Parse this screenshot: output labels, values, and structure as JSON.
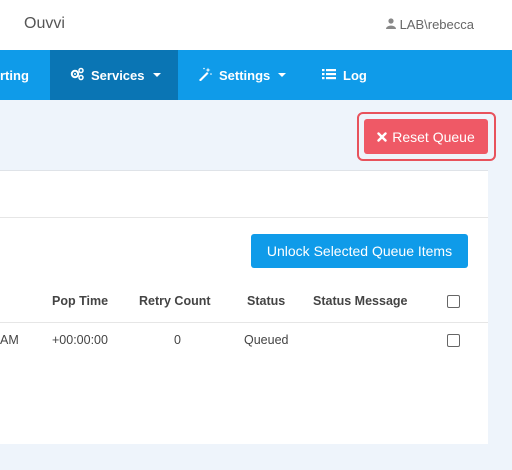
{
  "header": {
    "brand": "Ouvvi",
    "user": "LAB\\rebecca",
    "user_icon": "user-icon"
  },
  "nav": {
    "items": [
      {
        "label": "rting",
        "icon": ""
      },
      {
        "label": "Services",
        "icon": "gears-icon",
        "active": true,
        "dropdown": true
      },
      {
        "label": "Settings",
        "icon": "magic-wand-icon",
        "dropdown": true
      },
      {
        "label": "Log",
        "icon": "list-icon"
      }
    ]
  },
  "toolbar": {
    "reset_label": "Reset Queue",
    "reset_icon": "close-icon"
  },
  "panel": {
    "unlock_label": "Unlock Selected Queue Items",
    "columns": [
      "Pop Time",
      "Retry Count",
      "Status",
      "Status Message"
    ],
    "rows": [
      {
        "time_tail": "AM",
        "pop_time": "+00:00:00",
        "retry_count": "0",
        "status": "Queued",
        "status_message": ""
      }
    ]
  },
  "colors": {
    "nav": "#0f9be9",
    "nav_active": "#0a75b4",
    "danger": "#ef5966",
    "primary": "#0f9be9"
  }
}
